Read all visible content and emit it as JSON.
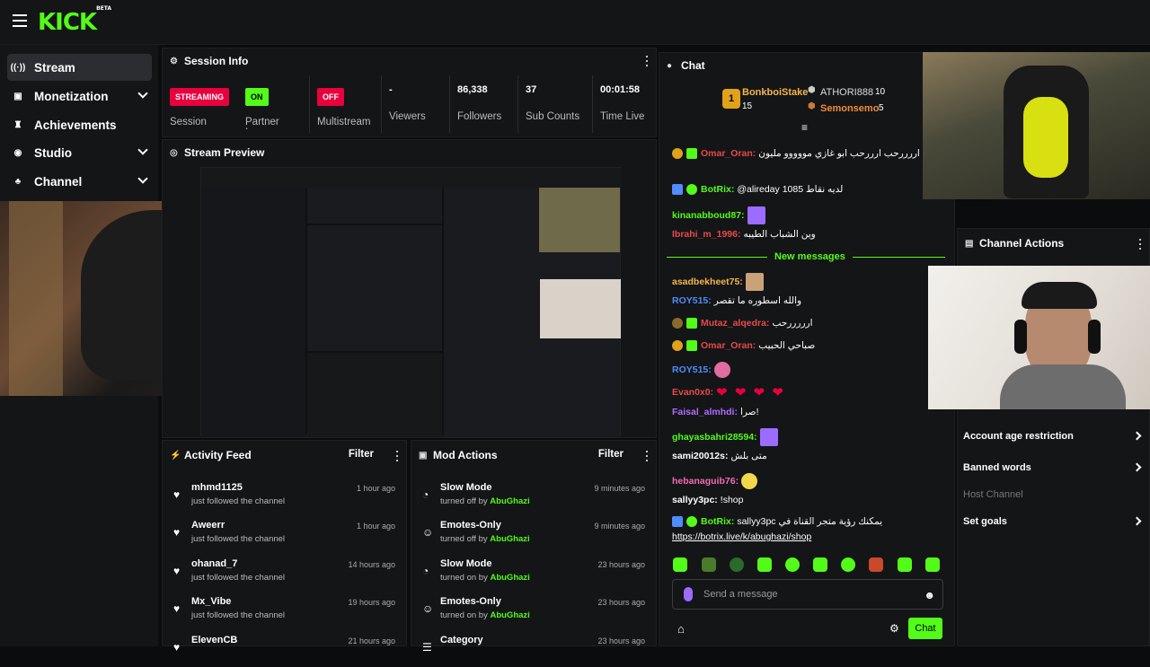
{
  "brand": {
    "logo": "KICK",
    "beta": "BETA"
  },
  "sidebar": {
    "items": [
      {
        "label": "Stream",
        "icon": "broadcast-icon"
      },
      {
        "label": "Monetization",
        "icon": "money-icon"
      },
      {
        "label": "Achievements",
        "icon": "trophy-icon"
      },
      {
        "label": "Studio",
        "icon": "studio-icon"
      },
      {
        "label": "Channel",
        "icon": "channel-icon"
      }
    ]
  },
  "session": {
    "title": "Session Info",
    "streaming": {
      "badge": "STREAMING",
      "label": "Session"
    },
    "partner": {
      "badge": "ON",
      "label": "Partner Income"
    },
    "multistream": {
      "badge": "OFF",
      "label": "Multistream"
    },
    "viewers": {
      "value": "-",
      "label": "Viewers"
    },
    "followers": {
      "value": "86,338",
      "label": "Followers"
    },
    "subs": {
      "value": "37",
      "label": "Sub Counts"
    },
    "time": {
      "value": "00:01:58",
      "label": "Time Live"
    }
  },
  "preview": {
    "title": "Stream Preview"
  },
  "activity": {
    "title": "Activity Feed",
    "filter": "Filter",
    "items": [
      {
        "name": "mhmd1125",
        "sub": "just followed the channel",
        "time": "1 hour ago"
      },
      {
        "name": "Aweerr",
        "sub": "just followed the channel",
        "time": "1 hour ago"
      },
      {
        "name": "ohanad_7",
        "sub": "just followed the channel",
        "time": "14 hours ago"
      },
      {
        "name": "Mx_Vibe",
        "sub": "just followed the channel",
        "time": "19 hours ago"
      },
      {
        "name": "ElevenCB",
        "sub": "",
        "time": "21 hours ago"
      }
    ]
  },
  "mod": {
    "title": "Mod Actions",
    "filter": "Filter",
    "items": [
      {
        "name": "Slow Mode",
        "pre": "turned off by",
        "by": "AbuGhazi",
        "time": "9 minutes ago"
      },
      {
        "name": "Emotes-Only",
        "pre": "turned off by",
        "by": "AbuGhazi",
        "time": "9 minutes ago"
      },
      {
        "name": "Slow Mode",
        "pre": "turned on by",
        "by": "AbuGhazi",
        "time": "23 hours ago"
      },
      {
        "name": "Emotes-Only",
        "pre": "turned on by",
        "by": "AbuGhazi",
        "time": "23 hours ago"
      },
      {
        "name": "Category",
        "pre": "",
        "by": "",
        "time": "23 hours ago"
      }
    ]
  },
  "chat": {
    "title": "Chat",
    "leaders": [
      {
        "name": "BonkboiStake",
        "count": "15",
        "rank": "1"
      },
      {
        "name": "ATHORI888",
        "count": "10"
      },
      {
        "name": "Semonsemo",
        "count": "5"
      }
    ],
    "new_messages": "New messages",
    "messages": [
      {
        "user": "Omar_Oran:",
        "text": "اررررحب ارررحب ابو غازي مووووو مليون",
        "color": "#e84a4a"
      },
      {
        "user": "BotRix:",
        "text": "@alireday 1085 لديه نقاط",
        "color": "#53fc18"
      },
      {
        "user": "kinanabboud87:",
        "text": "",
        "color": "#53fc18"
      },
      {
        "user": "Ibrahi_m_1996:",
        "text": "وين الشباب الطيبه",
        "color": "#e84a4a"
      },
      {
        "user": "asadbekheet75:",
        "text": "",
        "color": "#f2b84b"
      },
      {
        "user": "ROY515:",
        "text": "والله اسطوره ما تقصر",
        "color": "#4f8cff"
      },
      {
        "user": "Mutaz_alqedra:",
        "text": "ارررررحب",
        "color": "#e84a4a"
      },
      {
        "user": "Omar_Oran:",
        "text": "صباحي الحبيب",
        "color": "#e84a4a"
      },
      {
        "user": "ROY515:",
        "text": "",
        "color": "#4f8cff"
      },
      {
        "user": "Evan0x0:",
        "text": "",
        "color": "#e84a4a"
      },
      {
        "user": "Faisal_almhdi:",
        "text": "صرا!",
        "color": "#b06cff"
      },
      {
        "user": "ghayasbahri28594:",
        "text": "",
        "color": "#53fc18"
      },
      {
        "user": "sami20012s:",
        "text": "متى بلش",
        "color": "#fff"
      },
      {
        "user": "hebanaguib76:",
        "text": "",
        "color": "#f06cb4"
      },
      {
        "user": "sallyy3pc:",
        "text": "!shop",
        "color": "#fff"
      },
      {
        "user": "BotRix:",
        "text": "sallyy3pc يمكنك رؤية متجر القناة في",
        "color": "#53fc18"
      }
    ],
    "link": "https://botrix.live/k/abughazi/shop",
    "placeholder": "Send a message",
    "send": "Chat",
    "hearts": "❤ ❤ ❤ ❤"
  },
  "actions": {
    "title": "Channel Actions",
    "items": [
      "Account age restriction",
      "Banned words",
      "Host Channel",
      "Set goals"
    ]
  },
  "colors": {
    "accent": "#53fc18",
    "live": "#e8003d"
  }
}
